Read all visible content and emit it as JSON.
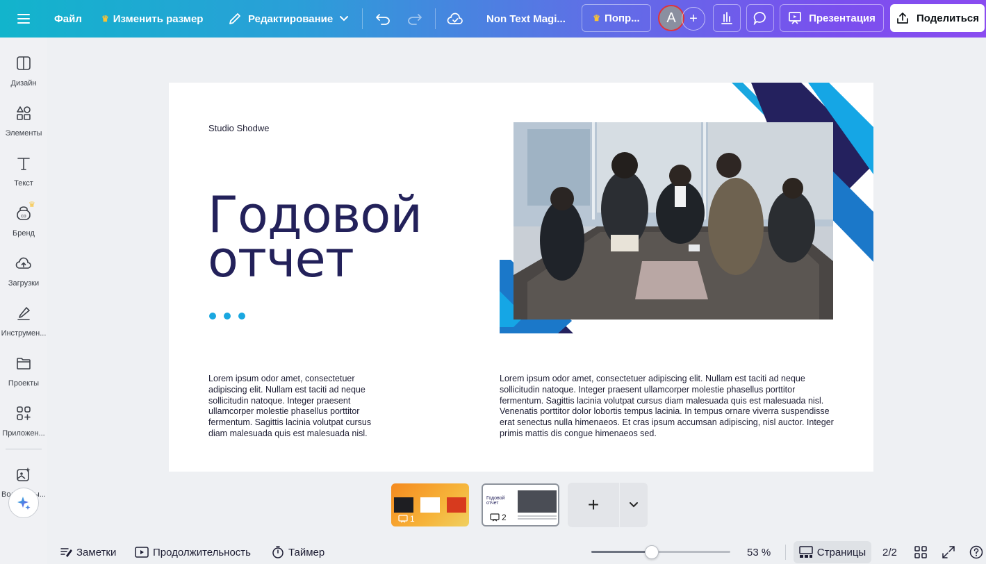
{
  "topbar": {
    "menu_icon": "hamburger-icon",
    "file_label": "Файл",
    "resize_label": "Изменить размер",
    "edit_label": "Редактирование",
    "doc_title": "Non Text Magi...",
    "try_label": "Попр...",
    "avatar_letter": "A",
    "present_label": "Презентация",
    "share_label": "Поделиться",
    "accent_color": "#f8c235"
  },
  "rail": {
    "items": [
      {
        "label": "Дизайн",
        "icon": "layout-icon"
      },
      {
        "label": "Элементы",
        "icon": "shapes-icon"
      },
      {
        "label": "Текст",
        "icon": "text-icon"
      },
      {
        "label": "Бренд",
        "icon": "brand-icon"
      },
      {
        "label": "Загрузки",
        "icon": "cloud-upload-icon"
      },
      {
        "label": "Инструмен...",
        "icon": "pen-tool-icon"
      },
      {
        "label": "Проекты",
        "icon": "folder-icon"
      },
      {
        "label": "Приложен...",
        "icon": "apps-icon"
      },
      {
        "label": "Волшебны...",
        "icon": "magic-media-icon"
      }
    ]
  },
  "slide": {
    "studio": "Studio Shodwe",
    "title_line1": "Годовой",
    "title_line2": "отчет",
    "body_left": "Lorem ipsum odor amet, consectetuer adipiscing elit. Nullam est taciti ad neque sollicitudin natoque. Integer praesent ullamcorper molestie phasellus porttitor fermentum. Sagittis lacinia volutpat cursus diam malesuada quis est malesuada nisl.",
    "body_right": "Lorem ipsum odor amet, consectetuer adipiscing elit. Nullam est taciti ad neque sollicitudin natoque. Integer praesent ullamcorper molestie phasellus porttitor fermentum. Sagittis lacinia volutpat cursus diam malesuada quis est malesuada nisl. Venenatis porttitor dolor lobortis tempus lacinia. In tempus ornare viverra suspendisse erat senectus nulla himenaeos. Et cras ipsum accumsan adipiscing, nisl auctor. Integer primis mattis dis congue himenaeos sed.",
    "title_color": "#23215a",
    "dot_color": "#1aa7e0"
  },
  "thumbnails": [
    {
      "number": "1"
    },
    {
      "number": "2",
      "mini_title": "Годовой отчет"
    }
  ],
  "bottombar": {
    "notes_label": "Заметки",
    "duration_label": "Продолжительность",
    "timer_label": "Таймер",
    "zoom_value": "53 %",
    "zoom_fraction": 0.53,
    "pages_label": "Страницы",
    "page_count": "2/2"
  }
}
